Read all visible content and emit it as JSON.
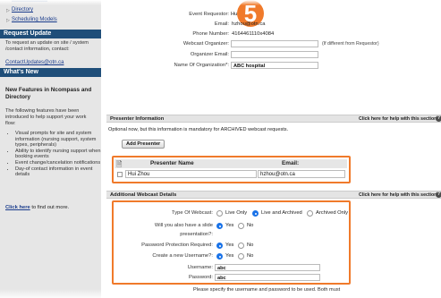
{
  "step_badge": "5",
  "sidebar": {
    "links": [
      "Directory",
      "Scheduling Models"
    ],
    "request_update_title": "Request Update",
    "request_update_text": "To request an update on site / system /contact information, contact:",
    "request_update_email": "ContactUpdates@otn.ca",
    "whats_new_title": "What's New",
    "new_features_title": "New Features in Ncompass and Directory",
    "new_features_intro": "The following features have been introduced to help support your work flow:",
    "features": [
      "Visual prompts for site and system information (nursing support, system types, peripherals)",
      "Ability to identify nursing support when booking events",
      "Event change/cancelation notifications",
      "Day-of contact information in event details"
    ],
    "click_here": "Click here",
    "find_out_more": " to find out more."
  },
  "requestor": {
    "event_requestor_label": "Event Requestor:",
    "event_requestor_value": "Hu",
    "email_label": "Email:",
    "email_value": "hzhou@otn.ca",
    "phone_label": "Phone Number:",
    "phone_value": "4164461110x4084",
    "webcast_organizer_label": "Webcast Organizer:",
    "webcast_organizer_value": "",
    "different_note": "(If different from Requestor)",
    "organizer_email_label": "Organizer Email:",
    "organizer_email_value": "",
    "org_name_label": "Name Of Organization*:",
    "org_name_value": "ABC hospital"
  },
  "presenter_section": {
    "title": "Presenter Information",
    "help": "Click here for help with this section",
    "note": "Optional now, but this information is mandatory for ARCHIVED webcast requests.",
    "add_button": "Add Presenter",
    "col_name": "Presenter Name",
    "col_email": "Email:",
    "row_name": "Hui Zhou",
    "row_email": "hzhou@otn.ca"
  },
  "webcast_section": {
    "title": "Additional Webcast Details",
    "help": "Click here for help with this section",
    "type_label": "Type Of Webcast:",
    "type_options": [
      "Live Only",
      "Live and Archived",
      "Archived Only"
    ],
    "slide_label_1": "Will you also have a slide",
    "slide_label_2": "presentation?:",
    "password_label": "Password Protection Required:",
    "username_new_label": "Create a new Username?:",
    "yes": "Yes",
    "no": "No",
    "username_label": "Username:",
    "username_value": "abc",
    "password_field_label": "Password:",
    "password_value": "abc",
    "footer_note": "Please specify the username and password to be used. Both must"
  },
  "colors": {
    "accent": "#f07a2b",
    "sidebar_header": "#1f4e79",
    "radio_selected": "#1a73e8"
  }
}
